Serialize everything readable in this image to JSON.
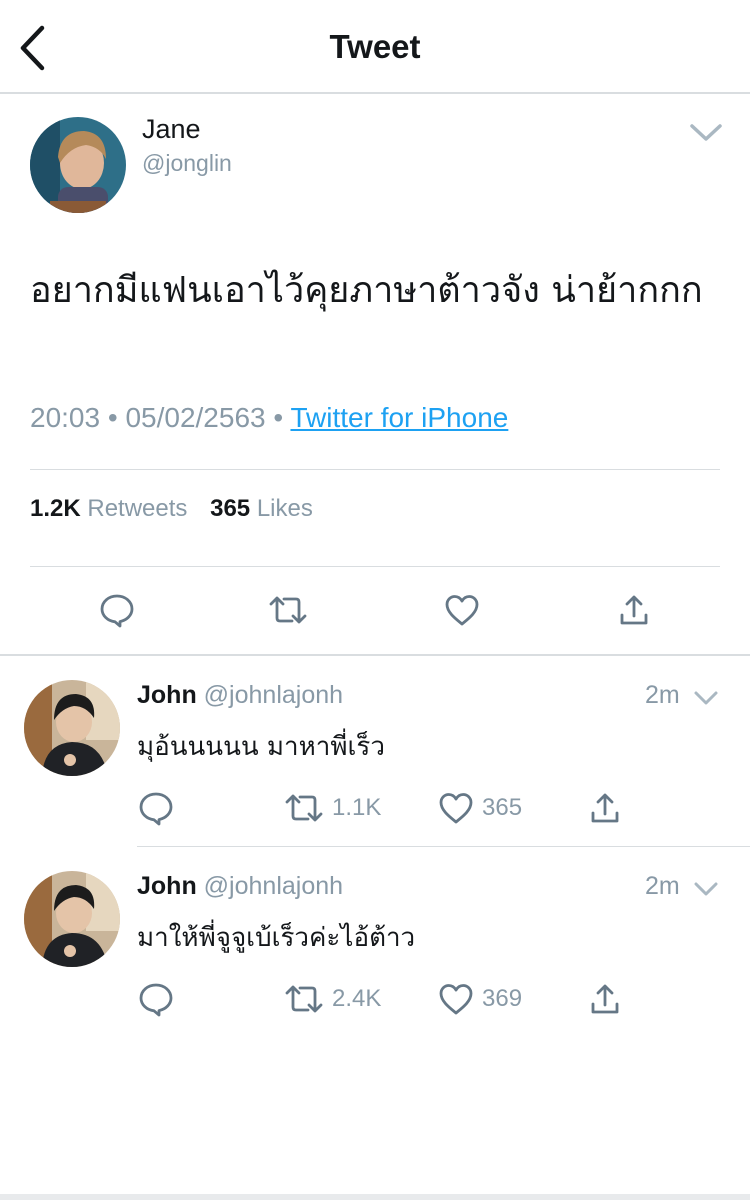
{
  "header": {
    "title": "Tweet",
    "back_icon": "chevron-left-icon"
  },
  "tweet": {
    "author_name": "Jane",
    "author_handle": "@jonglin",
    "text": "อยากมีแฟนเอาไว้คุยภาษาต้าวจัง น่าย้ากกก",
    "time": "20:03",
    "date": "05/02/2563",
    "separator": "•",
    "source": "Twitter for iPhone",
    "retweets_count": "1.2K",
    "retweets_label": "Retweets",
    "likes_count": "365",
    "likes_label": "Likes"
  },
  "replies": [
    {
      "name": "John",
      "handle": "@johnlajonh",
      "time": "2m",
      "text": "มุอ้นนนนน มาหาพี่เร็ว",
      "retweets": "1.1K",
      "likes": "365"
    },
    {
      "name": "John",
      "handle": "@johnlajonh",
      "time": "2m",
      "text": "มาให้พี่จูจูเบ้เร็วค่ะไอ้ต้าว",
      "retweets": "2.4K",
      "likes": "369"
    }
  ],
  "colors": {
    "link": "#1da1f2",
    "secondary_text": "#8899a6",
    "primary_text": "#14171a",
    "icon": "#657786",
    "divider": "#d9dde0"
  }
}
